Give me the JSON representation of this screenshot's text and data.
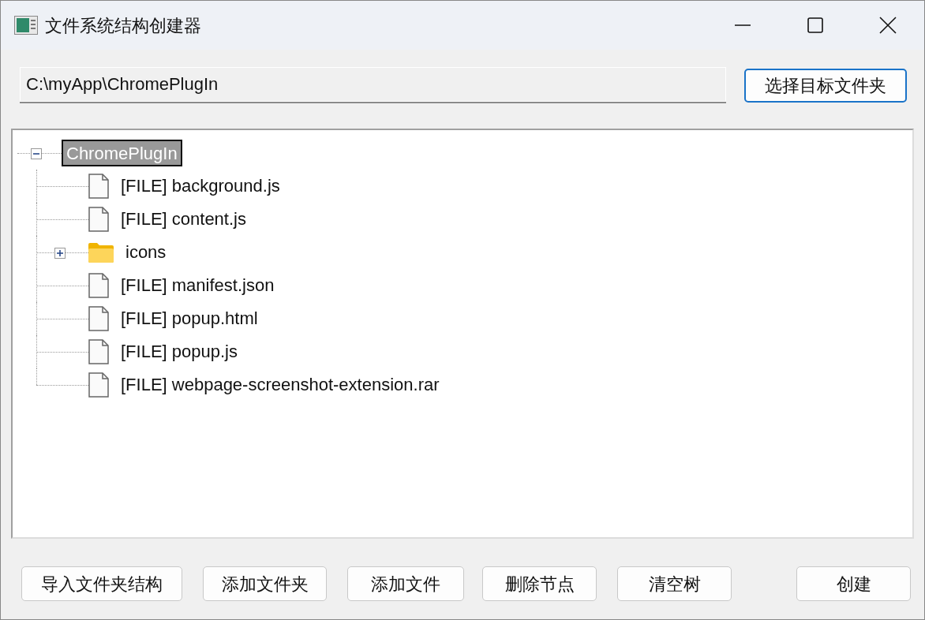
{
  "window": {
    "title": "文件系统结构创建器"
  },
  "path_field": {
    "value": "C:\\myApp\\ChromePlugIn"
  },
  "select_button": {
    "label": "选择目标文件夹"
  },
  "tree": {
    "label": "ChromePlugIn",
    "expanded": true,
    "selected": true,
    "children": [
      {
        "label": "[FILE] background.js",
        "kind": "file",
        "selected": false
      },
      {
        "label": "[FILE] content.js",
        "kind": "file",
        "selected": false
      },
      {
        "label": "icons",
        "kind": "folder",
        "expanded": false,
        "selected": false
      },
      {
        "label": "[FILE] manifest.json",
        "kind": "file",
        "selected": false
      },
      {
        "label": "[FILE] popup.html",
        "kind": "file",
        "selected": false
      },
      {
        "label": "[FILE] popup.js",
        "kind": "file",
        "selected": false
      },
      {
        "label": "[FILE] webpage-screenshot-extension.rar",
        "kind": "file",
        "selected": false
      }
    ]
  },
  "buttons": [
    {
      "label": "导入文件夹结构"
    },
    {
      "label": "添加文件夹"
    },
    {
      "label": "添加文件"
    },
    {
      "label": "删除节点"
    },
    {
      "label": "清空树"
    },
    {
      "label": "创建"
    }
  ]
}
